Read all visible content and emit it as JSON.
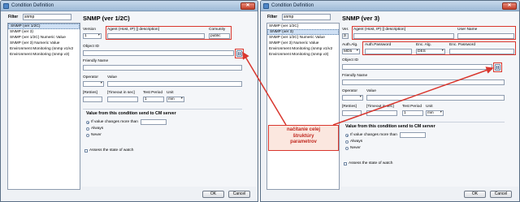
{
  "left_window": {
    "title": "Condition Definition",
    "filter_label": "Filter",
    "filter_value": "snmp",
    "list_items": [
      "SNMP (ver 1/2C)",
      "SNMP (ver 3)",
      "SNMP (ver 1/2C) Numeric Value",
      "SNMP (ver 3) Numeric Value",
      "Environment Monitoring (snmp v1/v2",
      "Environment Monitoring (snmp v3)"
    ],
    "panel": {
      "title": "SNMP (ver 1/2C)",
      "version_label": "Version",
      "version_value": "1",
      "agent_label": "Agent (Host, IP) [| description]",
      "community_label": "Comunity",
      "community_value": "public",
      "object_id_label": "Object ID",
      "friendly_name_label": "Friendly Name",
      "operator_label": "Operator",
      "value_label": "Value",
      "retries_label": "[Retries]",
      "timeout_label": "[Timeout in sec]",
      "test_period_label": "Test Period",
      "unit_label": "Unit",
      "test_period_value": "1",
      "unit_value": "min",
      "group_title": "Value from this condition send to CM server",
      "radio_options": [
        "If value changes more than",
        "Always",
        "Never"
      ],
      "assess_label": "Assess the state of watch"
    },
    "ok_label": "OK",
    "cancel_label": "Cancel"
  },
  "right_window": {
    "title": "Condition Definition",
    "filter_label": "Filter",
    "filter_value": "snmp",
    "list_items": [
      "SNMP (ver 1/2C)",
      "SNMP (ver 3)",
      "SNMP (ver 1/2C) Numeric Value",
      "SNMP (ver 3) Numeric Value",
      "Environment Monitoring (snmp v1/v2",
      "Environment Monitoring (snmp v3)"
    ],
    "panel": {
      "title": "SNMP (ver 3)",
      "ver_label": "Ver.",
      "ver_value": "3",
      "agent_label": "Agent (Host, IP) [| description]",
      "user_name_label": "User Name",
      "auth_alg_label": "Auth.Alg.",
      "auth_alg_value": "MD5",
      "auth_password_label": "Auth.Password",
      "enc_alg_label": "Enc. Alg.",
      "enc_alg_value": "DES",
      "enc_password_label": "Enc. Password",
      "object_id_label": "Object ID",
      "friendly_name_label": "Friendly Name",
      "operator_label": "Operator",
      "value_label": "Value",
      "retries_label": "[Retries]",
      "timeout_label": "[Timeout in sec]",
      "test_period_label": "Test Period",
      "unit_label": "Unit",
      "test_period_value": "1",
      "unit_value": "min",
      "group_title": "Value from this condition send to CM server",
      "radio_options": [
        "If value changes more than",
        "Always",
        "Never"
      ],
      "assess_label": "Assess the state of watch"
    },
    "ok_label": "OK",
    "cancel_label": "Cancel"
  },
  "annotation": {
    "lines": [
      "načítanie celej",
      "štruktúry",
      "parametrov"
    ],
    "color": "#d9362d"
  }
}
